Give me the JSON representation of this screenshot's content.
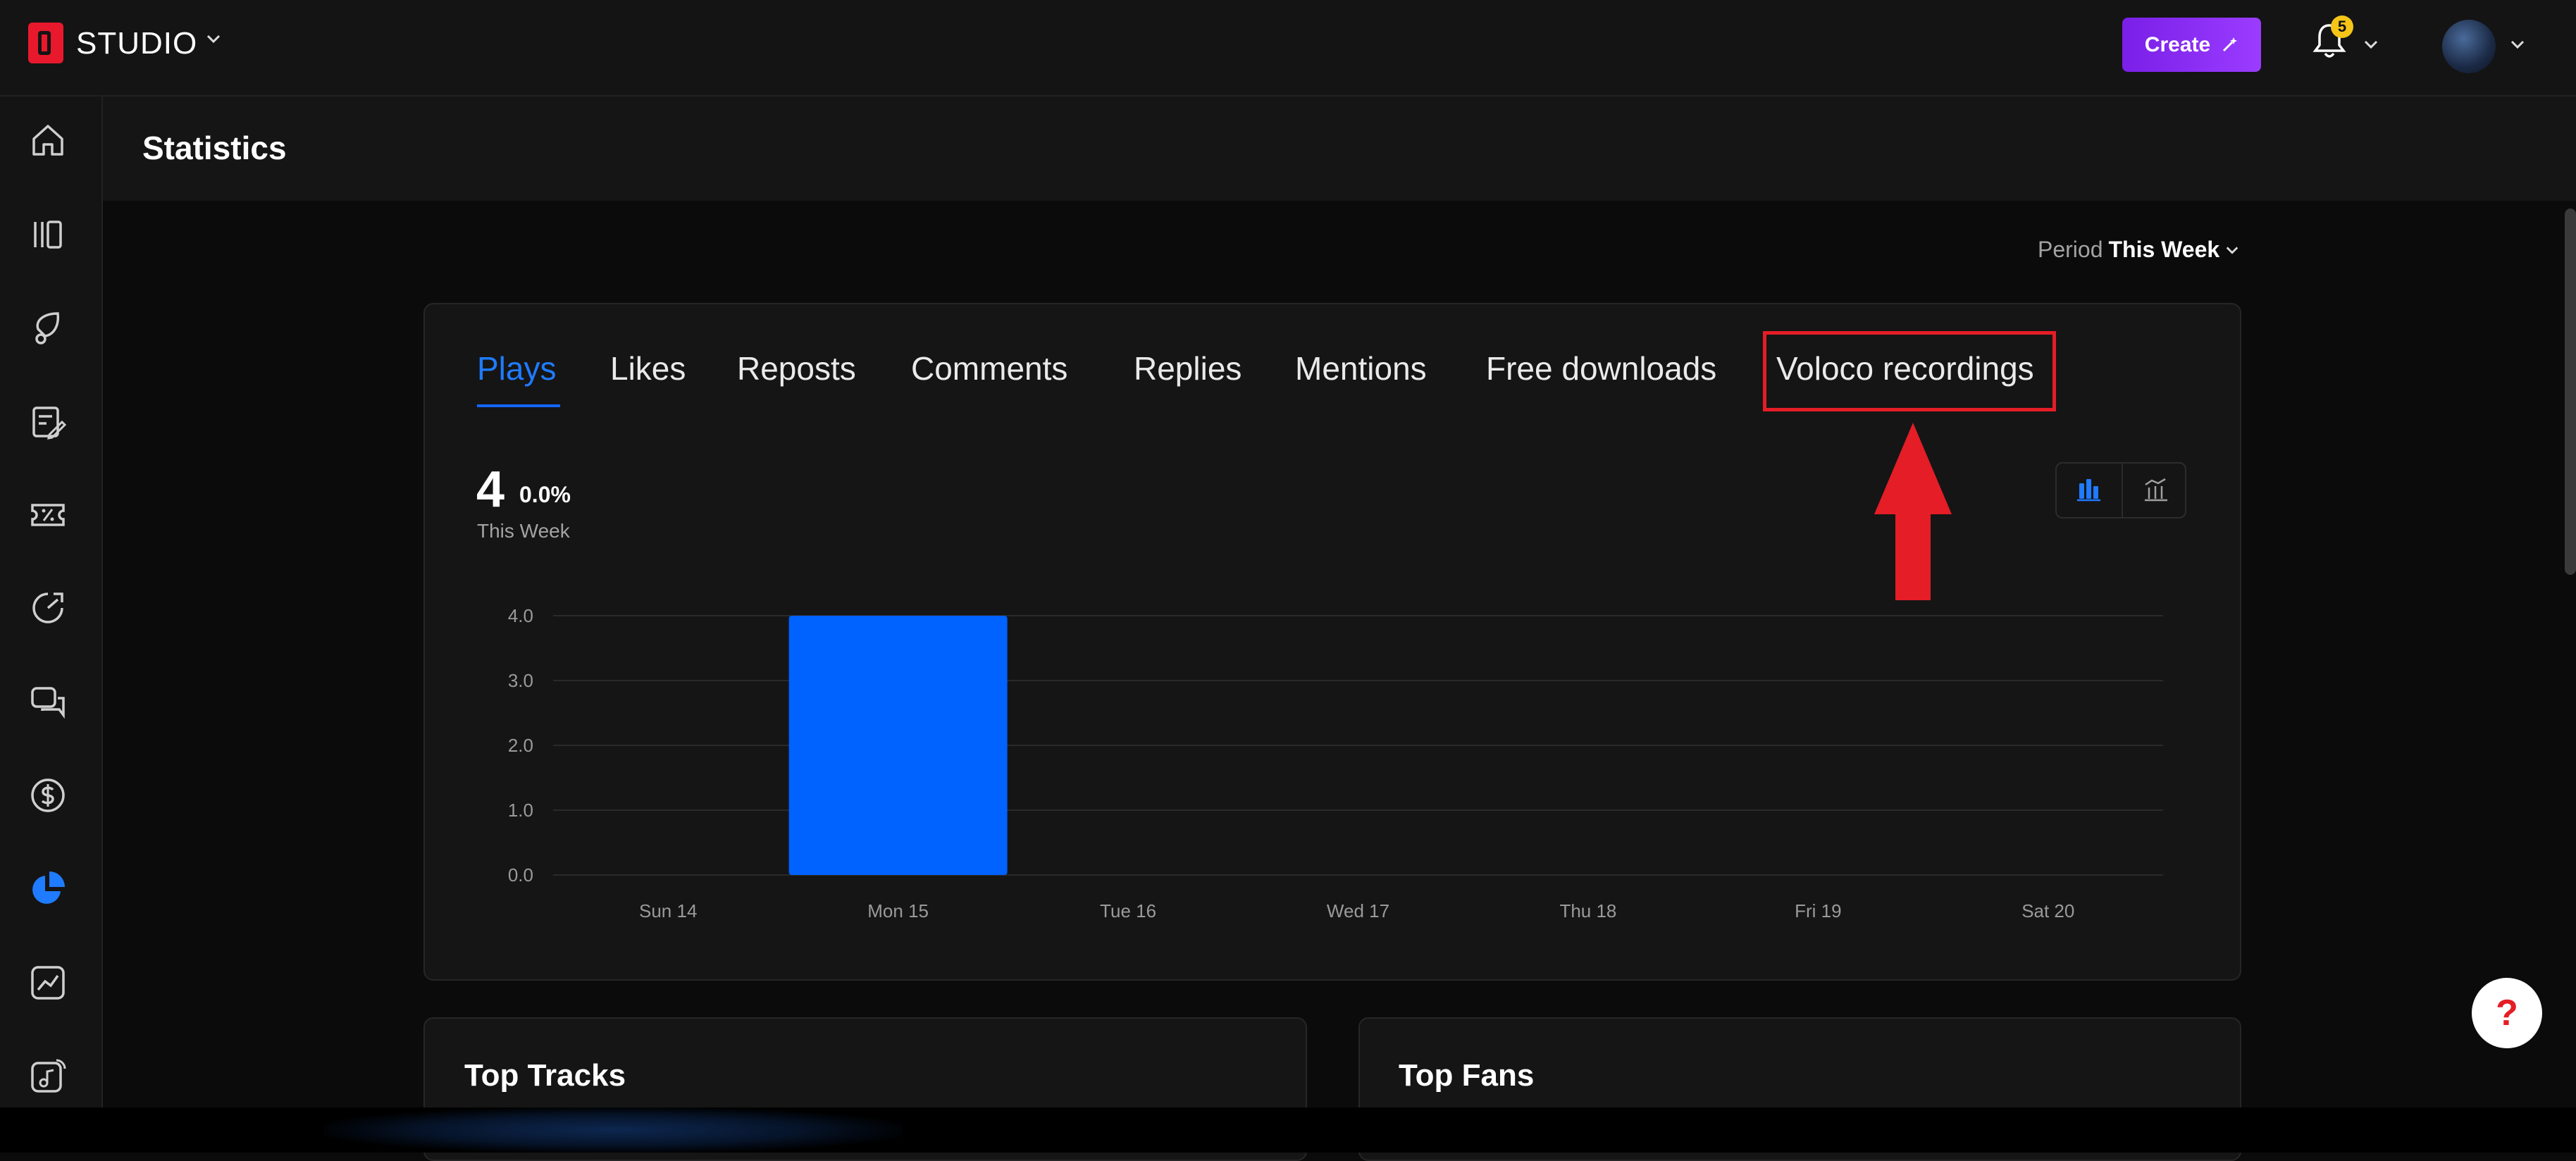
{
  "header": {
    "brand_label": "STUDIO",
    "create_label": "Create",
    "notification_count": "5"
  },
  "sidebar": {
    "items": [
      {
        "name": "home-icon"
      },
      {
        "name": "library-icon"
      },
      {
        "name": "promote-icon"
      },
      {
        "name": "edit-notes-icon"
      },
      {
        "name": "discount-ticket-icon"
      },
      {
        "name": "speed-gauge-icon"
      },
      {
        "name": "messages-icon"
      },
      {
        "name": "dollar-icon"
      },
      {
        "name": "pie-chart-icon",
        "active": true
      },
      {
        "name": "trending-chart-icon"
      },
      {
        "name": "audio-music-icon"
      }
    ]
  },
  "page": {
    "title": "Statistics"
  },
  "period": {
    "label": "Period",
    "value": "This Week"
  },
  "tabs": [
    {
      "label": "Plays",
      "active": true
    },
    {
      "label": "Likes"
    },
    {
      "label": "Reposts"
    },
    {
      "label": "Comments"
    },
    {
      "label": "Replies"
    },
    {
      "label": "Mentions"
    },
    {
      "label": "Free downloads"
    },
    {
      "label": "Voloco recordings",
      "highlighted": true
    }
  ],
  "summary": {
    "value": "4",
    "change": "0.0%",
    "period_label": "This Week"
  },
  "chart_data": {
    "type": "bar",
    "categories": [
      "Sun 14",
      "Mon 15",
      "Tue 16",
      "Wed 17",
      "Thu 18",
      "Fri 19",
      "Sat 20"
    ],
    "values": [
      0,
      4,
      0,
      0,
      0,
      0,
      0
    ],
    "y_ticks": [
      "0.0",
      "1.0",
      "2.0",
      "3.0",
      "4.0"
    ],
    "ylim": [
      0,
      4
    ],
    "grid": true,
    "bar_color": "#0062ff"
  },
  "lower_cards": {
    "top_tracks": "Top Tracks",
    "top_fans": "Top Fans"
  },
  "help": {
    "label": "?"
  },
  "colors": {
    "accent": "#1565ff",
    "highlight": "#e41d26",
    "create": "#8a2be2"
  }
}
